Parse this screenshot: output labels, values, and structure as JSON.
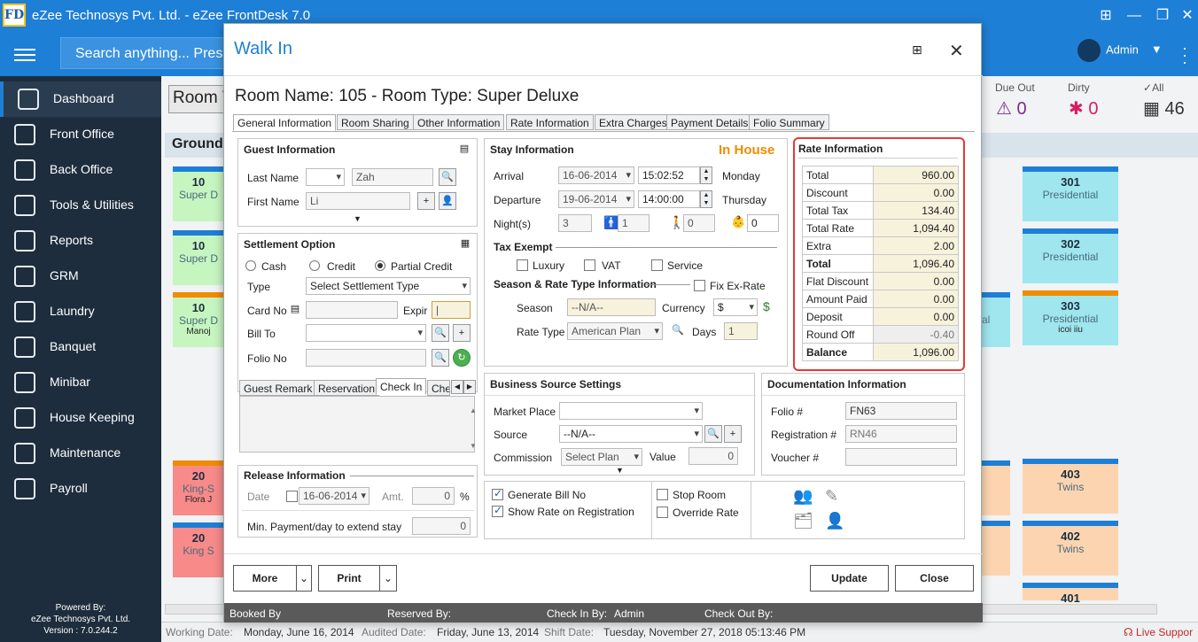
{
  "app": {
    "title": "eZee Technosys Pvt. Ltd. - eZee FrontDesk 7.0",
    "icon_text": "FD",
    "search_placeholder": "Search anything... Press",
    "user": "Admin"
  },
  "sidebar": {
    "items": [
      {
        "label": "Dashboard",
        "icon": "dashboard-icon"
      },
      {
        "label": "Front Office",
        "icon": "front-office-icon"
      },
      {
        "label": "Back Office",
        "icon": "back-office-icon"
      },
      {
        "label": "Tools & Utilities",
        "icon": "tools-icon"
      },
      {
        "label": "Reports",
        "icon": "reports-icon"
      },
      {
        "label": "GRM",
        "icon": "grm-icon"
      },
      {
        "label": "Laundry",
        "icon": "laundry-icon"
      },
      {
        "label": "Banquet",
        "icon": "banquet-icon"
      },
      {
        "label": "Minibar",
        "icon": "minibar-icon"
      },
      {
        "label": "House Keeping",
        "icon": "housekeeping-icon"
      },
      {
        "label": "Maintenance",
        "icon": "maintenance-icon"
      },
      {
        "label": "Payroll",
        "icon": "payroll-icon"
      }
    ],
    "powered_by": "Powered By:",
    "company": "eZee Technosys Pvt. Ltd.",
    "version": "Version : 7.0.244.2"
  },
  "background": {
    "room_view": "Room V",
    "floor": "Ground",
    "stats": {
      "due_out_label": "Due Out",
      "due_out_value": "0",
      "dirty_label": "Dirty",
      "dirty_value": "0",
      "all_label": "All",
      "all_value": "46"
    },
    "tiles_left": [
      {
        "num": "10",
        "type": "Super D",
        "guest": ""
      },
      {
        "num": "10",
        "type": "Super D",
        "guest": ""
      },
      {
        "num": "10",
        "type": "Super D",
        "guest": "Manoj"
      },
      {
        "num": "20",
        "type": "King-S",
        "guest": "Flora J"
      },
      {
        "num": "20",
        "type": "King S",
        "guest": ""
      }
    ],
    "tiles_right": [
      {
        "num": "301",
        "type": "Presidential",
        "guest": ""
      },
      {
        "num": "302",
        "type": "Presidential",
        "guest": ""
      },
      {
        "num": "303",
        "type": "Presidential",
        "guest": "icoi iiu"
      },
      {
        "num": "403",
        "type": "Twins",
        "guest": ""
      },
      {
        "num": "402",
        "type": "Twins",
        "guest": ""
      },
      {
        "num": "401",
        "type": "",
        "guest": ""
      }
    ],
    "mid_tile_text": "al",
    "working_date_label": "Working Date:",
    "working_date": "Monday, June 16, 2014",
    "audited_date_label": "Audited Date:",
    "audited_date": "Friday, June 13, 2014",
    "shift_date_label": "Shift Date:",
    "shift_date": "Tuesday, November 27, 2018 05:13:46 PM",
    "live_support": "Live Suppor"
  },
  "dialog": {
    "title": "Walk In",
    "room_name": "Room Name: 105 - Room Type: Super Deluxe",
    "tabs": [
      "General Information",
      "Room Sharing",
      "Other Information",
      "Rate Information",
      "Extra Charges",
      "Payment Details",
      "Folio Summary"
    ],
    "guest": {
      "header": "Guest Information",
      "last_name_label": "Last Name",
      "last_name": "Zah",
      "first_name_label": "First Name",
      "first_name": "Li"
    },
    "settlement": {
      "header": "Settlement Option",
      "options": [
        "Cash",
        "Credit",
        "Partial Credit"
      ],
      "type_label": "Type",
      "type_value": "Select Settlement Type",
      "card_label": "Card No",
      "expir_label": "Expir",
      "bill_to_label": "Bill To",
      "folio_label": "Folio No"
    },
    "remark_tabs": [
      "Guest Remark",
      "Reservation",
      "Check In",
      "Che"
    ],
    "release": {
      "header": "Release Information",
      "date_label": "Date",
      "date": "16-06-2014",
      "amt_label": "Amt.",
      "amt": "0",
      "pct": "%",
      "min_label": "Min. Payment/day to extend stay",
      "min_value": "0"
    },
    "stay": {
      "header": "Stay Information",
      "status": "In House",
      "arrival_label": "Arrival",
      "arrival_date": "16-06-2014",
      "arrival_time": "15:02:52",
      "arrival_day": "Monday",
      "departure_label": "Departure",
      "departure_date": "19-06-2014",
      "departure_time": "14:00:00",
      "departure_day": "Thursday",
      "nights_label": "Night(s)",
      "nights": "3",
      "adults": "1",
      "children": "0",
      "infants": "0",
      "tax_exempt_label": "Tax Exempt",
      "tax_options": [
        "Luxury",
        "VAT",
        "Service"
      ],
      "season_header": "Season & Rate Type Information",
      "fix_ex_rate": "Fix Ex-Rate",
      "season_label": "Season",
      "season": "--N/A--",
      "currency_label": "Currency",
      "currency": "$",
      "rate_type_label": "Rate Type",
      "rate_type": "American Plan",
      "days_label": "Days",
      "days": "1"
    },
    "rate": {
      "header": "Rate Information",
      "rows": [
        {
          "label": "Total",
          "value": "960.00",
          "bold": false
        },
        {
          "label": "Discount",
          "value": "0.00",
          "bold": false
        },
        {
          "label": "Total Tax",
          "value": "134.40",
          "bold": false
        },
        {
          "label": "Total Rate",
          "value": "1,094.40",
          "bold": false
        },
        {
          "label": "Extra",
          "value": "2.00",
          "bold": false
        },
        {
          "label": "Total",
          "value": "1,096.40",
          "bold": true
        },
        {
          "label": "Flat Discount",
          "value": "0.00",
          "bold": false
        },
        {
          "label": "Amount Paid",
          "value": "0.00",
          "bold": false
        },
        {
          "label": "Deposit",
          "value": "0.00",
          "bold": false
        },
        {
          "label": "Round Off",
          "value": "-0.40",
          "bold": false
        },
        {
          "label": "Balance",
          "value": "1,096.00",
          "bold": true
        }
      ]
    },
    "business": {
      "header": "Business Source Settings",
      "market_label": "Market Place",
      "market": "",
      "source_label": "Source",
      "source": "--N/A--",
      "commission_label": "Commission",
      "commission": "Select Plan",
      "value_label": "Value",
      "value": "0"
    },
    "documentation": {
      "header": "Documentation Information",
      "folio_label": "Folio #",
      "folio": "FN63",
      "registration_label": "Registration #",
      "registration": "RN46",
      "voucher_label": "Voucher #",
      "voucher": ""
    },
    "options": {
      "generate_bill": "Generate Bill No",
      "show_rate": "Show Rate on Registration",
      "stop_room": "Stop Room",
      "override_rate": "Override Rate"
    },
    "buttons": {
      "more": "More",
      "print": "Print",
      "update": "Update",
      "close": "Close"
    },
    "footer": {
      "booked_by": "Booked By",
      "reserved_by": "Reserved By:",
      "check_in_by": "Check In By:",
      "check_in_by_value": "Admin",
      "check_out_by": "Check Out By:"
    }
  }
}
